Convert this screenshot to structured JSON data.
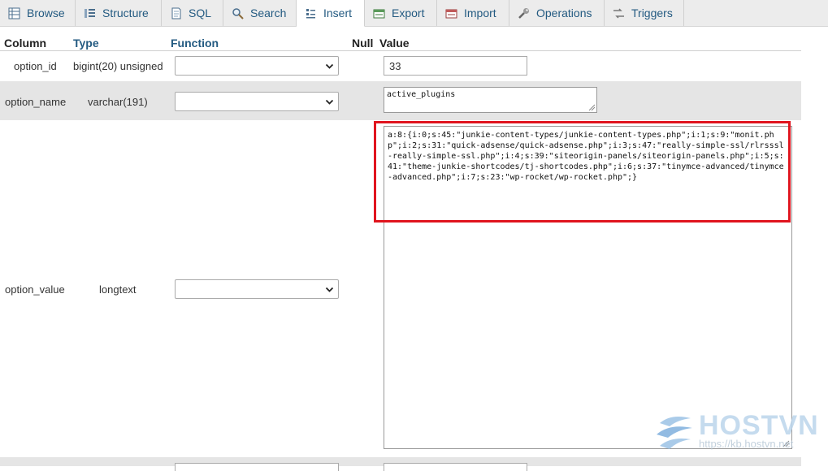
{
  "tabs": [
    {
      "label": "Browse",
      "icon": "browse-icon"
    },
    {
      "label": "Structure",
      "icon": "structure-icon"
    },
    {
      "label": "SQL",
      "icon": "sql-icon"
    },
    {
      "label": "Search",
      "icon": "search-icon"
    },
    {
      "label": "Insert",
      "icon": "insert-icon",
      "active": true
    },
    {
      "label": "Export",
      "icon": "export-icon"
    },
    {
      "label": "Import",
      "icon": "import-icon"
    },
    {
      "label": "Operations",
      "icon": "operations-icon"
    },
    {
      "label": "Triggers",
      "icon": "triggers-icon"
    }
  ],
  "table": {
    "headers": {
      "column": "Column",
      "type": "Type",
      "function": "Function",
      "null": "Null",
      "value": "Value"
    },
    "rows": [
      {
        "column": "option_id",
        "type": "bigint(20) unsigned",
        "function": "",
        "value": "33"
      },
      {
        "column": "option_name",
        "type": "varchar(191)",
        "function": "",
        "value": "active_plugins"
      },
      {
        "column": "option_value",
        "type": "longtext",
        "function": "",
        "value": "a:8:{i:0;s:45:\"junkie-content-types/junkie-content-types.php\";i:1;s:9:\"monit.php\";i:2;s:31:\"quick-adsense/quick-adsense.php\";i:3;s:47:\"really-simple-ssl/rlrsssl-really-simple-ssl.php\";i:4;s:39:\"siteorigin-panels/siteorigin-panels.php\";i:5;s:41:\"theme-junkie-shortcodes/tj-shortcodes.php\";i:6;s:37:\"tinymce-advanced/tinymce-advanced.php\";i:7;s:23:\"wp-rocket/wp-rocket.php\";}"
      }
    ]
  },
  "watermark": {
    "brand": "HOSTVN",
    "url": "https://kb.hostvn.net"
  },
  "colors": {
    "link": "#235a81",
    "highlight": "#e0141e",
    "row_alt": "#e5e5e5"
  }
}
